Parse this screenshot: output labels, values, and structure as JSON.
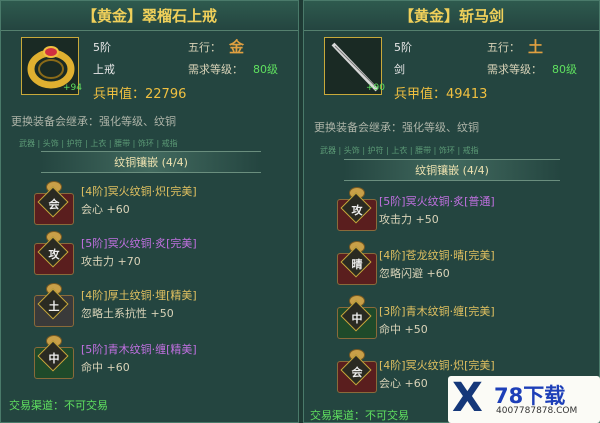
{
  "left": {
    "title": "【黄金】翠榴石上戒",
    "level": "5阶",
    "element_label": "五行：",
    "element_glyph": "金",
    "slot": "上戒",
    "req_label": "需求等级：",
    "req_value": "80级",
    "plus": "+94",
    "defense": "兵甲值：22796",
    "inherit": "更换装备会继承：强化等级、纹铜",
    "tabs": "武器 | 头饰 | 护符 | 上衣 | 腰带 | 饰环 | 戒指",
    "section": "纹铜镶嵌 (4/4)",
    "gems": [
      {
        "char": "会",
        "color": "red",
        "name": "[4阶]冥火纹铜·炽[完美]",
        "name_color": "gold",
        "stat": "会心 +60"
      },
      {
        "char": "攻",
        "color": "red",
        "name": "[5阶]冥火纹铜·炙[完美]",
        "name_color": "purple",
        "stat": "攻击力 +70"
      },
      {
        "char": "土",
        "color": "grey",
        "name": "[4阶]厚土纹铜·埋[精美]",
        "name_color": "gold",
        "stat": "忽略土系抗性 +50"
      },
      {
        "char": "中",
        "color": "green",
        "name": "[5阶]青木纹铜·缠[精美]",
        "name_color": "purple",
        "stat": "命中 +60"
      }
    ],
    "trade": "交易渠道：不可交易"
  },
  "right": {
    "title": "【黄金】斩马剑",
    "level": "5阶",
    "element_label": "五行：",
    "element_glyph": "土",
    "slot": "剑",
    "req_label": "需求等级：",
    "req_value": "80级",
    "plus": "+90",
    "defense": "兵甲值：49413",
    "inherit": "更换装备会继承：强化等级、纹铜",
    "tabs": "武器 | 头饰 | 护符 | 上衣 | 腰带 | 饰环 | 戒指",
    "section": "纹铜镶嵌 (4/4)",
    "gems": [
      {
        "char": "攻",
        "color": "red",
        "name": "[5阶]冥火纹铜·炙[普通]",
        "name_color": "purple",
        "stat": "攻击力 +50"
      },
      {
        "char": "晴",
        "color": "red",
        "name": "[4阶]苍龙纹铜·晴[完美]",
        "name_color": "gold",
        "stat": "忽略闪避 +60"
      },
      {
        "char": "中",
        "color": "green",
        "name": "[3阶]青木纹铜·缠[完美]",
        "name_color": "gold",
        "stat": "命中 +50"
      },
      {
        "char": "会",
        "color": "red",
        "name": "[4阶]冥火纹铜·炽[完美]",
        "name_color": "gold",
        "stat": "会心 +60"
      }
    ],
    "trade": "交易渠道：不可交易"
  },
  "watermark": {
    "x": "X",
    "top": "78下载",
    "bottom": "4007787878.COM"
  }
}
